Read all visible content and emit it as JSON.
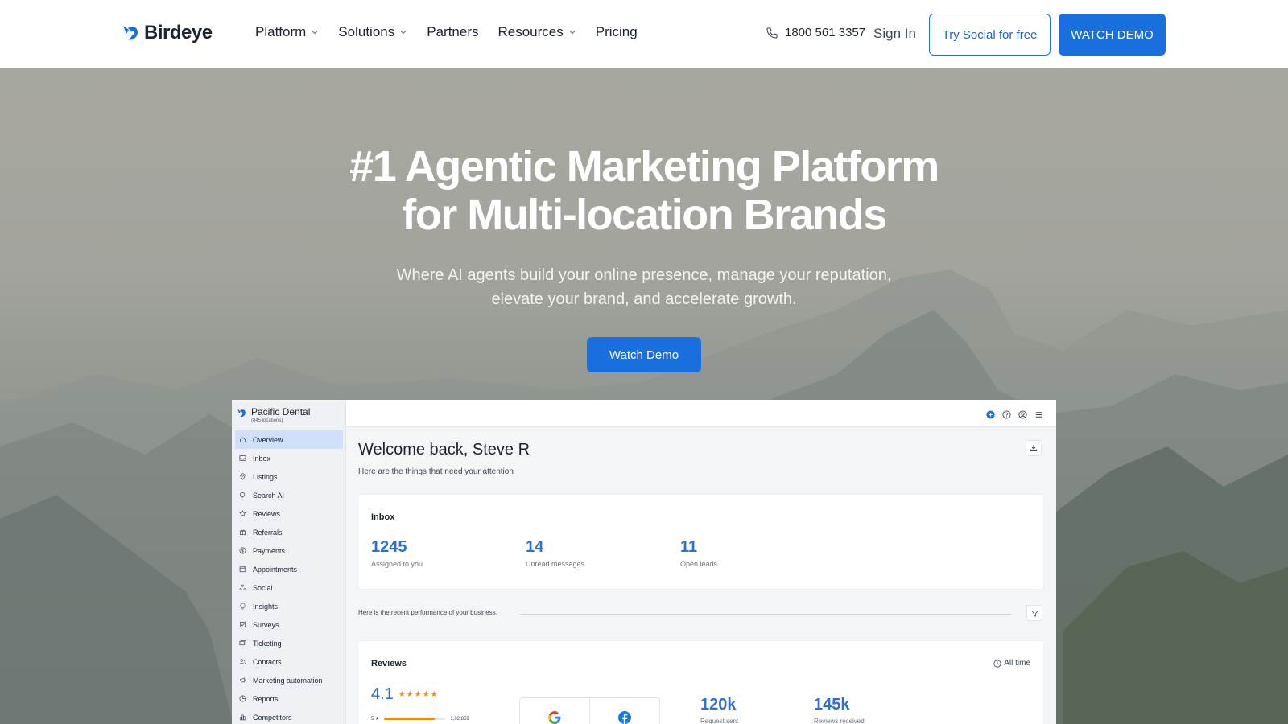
{
  "brand": {
    "name": "Birdeye",
    "color": "#1a6fde"
  },
  "nav": {
    "items": [
      {
        "label": "Platform",
        "has_menu": true
      },
      {
        "label": "Solutions",
        "has_menu": true
      },
      {
        "label": "Partners",
        "has_menu": false
      },
      {
        "label": "Resources",
        "has_menu": true
      },
      {
        "label": "Pricing",
        "has_menu": false
      }
    ],
    "phone": "1800 561 3357",
    "sign_in": "Sign In",
    "try_social": "Try Social for free",
    "watch_demo": "WATCH DEMO"
  },
  "hero": {
    "title_line1": "#1 Agentic Marketing Platform",
    "title_line2": "for Multi-location Brands",
    "subtitle_line1": "Where AI agents build your online presence, manage your reputation,",
    "subtitle_line2": "elevate your brand, and accelerate growth.",
    "cta": "Watch Demo"
  },
  "dashboard": {
    "org_name": "Pacific Dental",
    "org_sub": "(845 locations)",
    "sidebar": [
      {
        "label": "Overview",
        "icon": "home-icon",
        "active": true
      },
      {
        "label": "Inbox",
        "icon": "inbox-icon",
        "active": false
      },
      {
        "label": "Listings",
        "icon": "location-icon",
        "active": false
      },
      {
        "label": "Search AI",
        "icon": "search-ai-icon",
        "active": false
      },
      {
        "label": "Reviews",
        "icon": "star-icon",
        "active": false
      },
      {
        "label": "Referrals",
        "icon": "gift-icon",
        "active": false
      },
      {
        "label": "Payments",
        "icon": "dollar-icon",
        "active": false
      },
      {
        "label": "Appointments",
        "icon": "calendar-icon",
        "active": false
      },
      {
        "label": "Social",
        "icon": "social-icon",
        "active": false
      },
      {
        "label": "Insights",
        "icon": "bulb-icon",
        "active": false
      },
      {
        "label": "Surveys",
        "icon": "checklist-icon",
        "active": false
      },
      {
        "label": "Ticketing",
        "icon": "ticket-icon",
        "active": false
      },
      {
        "label": "Contacts",
        "icon": "contacts-icon",
        "active": false
      },
      {
        "label": "Marketing automation",
        "icon": "megaphone-icon",
        "active": false
      },
      {
        "label": "Reports",
        "icon": "pie-icon",
        "active": false
      },
      {
        "label": "Competitors",
        "icon": "bar-chart-icon",
        "active": false
      }
    ],
    "welcome": "Welcome back, Steve R",
    "welcome_sub": "Here are the things that need your attention",
    "inbox": {
      "title": "Inbox",
      "stats": [
        {
          "value": "1245",
          "label": "Assigned to you"
        },
        {
          "value": "14",
          "label": "Unread messages"
        },
        {
          "value": "11",
          "label": "Open leads"
        }
      ]
    },
    "performance_text": "Here is the recent performance of your business.",
    "reviews": {
      "title": "Reviews",
      "period": "All time",
      "rating": "4.1",
      "stars": "★★★★★",
      "bar": {
        "label": "5 ★",
        "count": "1,02,859",
        "fraction": 0.82
      },
      "stats": [
        {
          "value": "120k",
          "label": "Request sent"
        },
        {
          "value": "145k",
          "label": "Reviews received"
        }
      ]
    }
  }
}
